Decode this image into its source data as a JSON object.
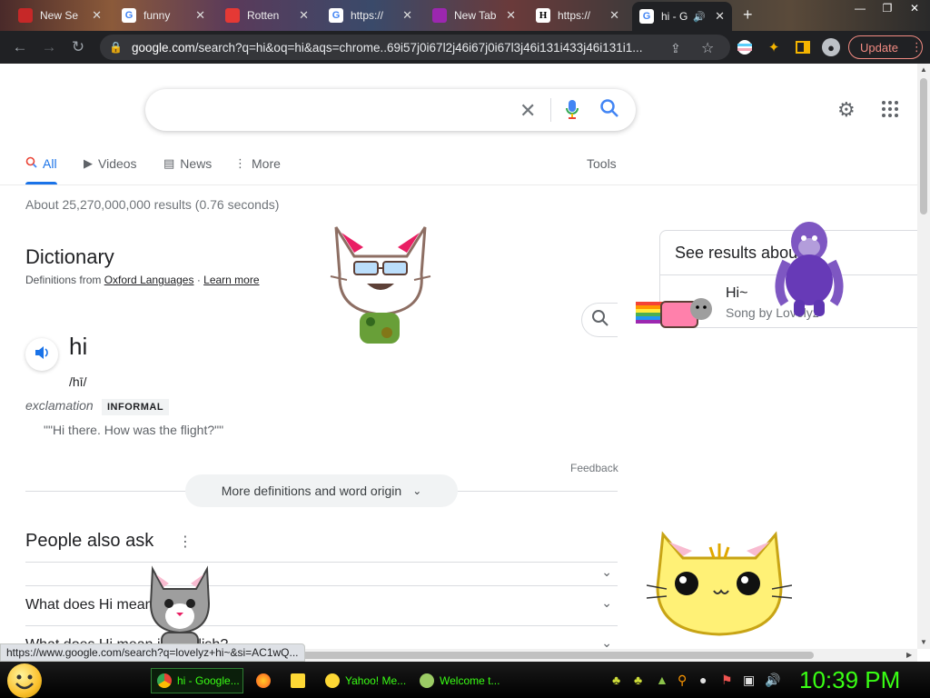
{
  "browser": {
    "tabs": [
      {
        "title": "New Se",
        "favicon_color": "#c62828",
        "active": false
      },
      {
        "title": "funny",
        "favicon_color": "#4285f4",
        "active": false
      },
      {
        "title": "Rotten",
        "favicon_color": "#e53935",
        "active": false
      },
      {
        "title": "https://",
        "favicon_color": "#4285f4",
        "active": false
      },
      {
        "title": "New Tab",
        "favicon_color": "#9c27b0",
        "active": false
      },
      {
        "title": "https://",
        "favicon_letter": "H",
        "favicon_color": "#ffffff",
        "active": false
      },
      {
        "title": "hi - G",
        "favicon_color": "#4285f4",
        "active": true
      }
    ],
    "url_domain": "google.com",
    "url_rest": "/search?q=hi&oq=hi&aqs=chrome..69i57j0i67l2j46i67j0i67l3j46i131i433j46i131i1...",
    "update_label": "Update"
  },
  "search": {
    "query": ""
  },
  "nav_tabs": [
    {
      "label": "All",
      "icon": "search-icon",
      "active": true
    },
    {
      "label": "Videos",
      "icon": "video-icon",
      "active": false
    },
    {
      "label": "News",
      "icon": "news-icon",
      "active": false
    },
    {
      "label": "More",
      "icon": "more-vert-icon",
      "active": false
    }
  ],
  "tools_label": "Tools",
  "result_stats": "About 25,270,000,000 results (0.76 seconds)",
  "dictionary": {
    "title": "Dictionary",
    "source_prefix": "Definitions from",
    "source_link": "Oxford Languages",
    "separator": "·",
    "learn_more": "Learn more",
    "word": "hi",
    "pronunciation": "/hī/",
    "part_of_speech": "exclamation",
    "register": "INFORMAL",
    "example": "\"\"Hi there. How was the flight?\"\"",
    "feedback": "Feedback",
    "more_definitions": "More definitions and word origin"
  },
  "people_also_ask": {
    "title": "People also ask",
    "questions": [
      "",
      "What does Hi mean?",
      "What does Hi mean in English?"
    ]
  },
  "knowledge_panel": {
    "title": "See results about",
    "item_name": "Hi~",
    "item_subtitle": "Song by Lovelyz"
  },
  "status_url": "https://www.google.com/search?q=lovelyz+hi~&si=AC1wQ...",
  "taskbar": {
    "buttons": [
      {
        "label": "hi - Google...",
        "active": true,
        "icon_color": "#4285f4"
      },
      {
        "label": "",
        "active": false,
        "icon_color": "#ff7043"
      },
      {
        "label": "",
        "active": false,
        "icon_color": "#fdd835"
      },
      {
        "label": "Yahoo! Me...",
        "active": false,
        "icon_color": "#fdd835"
      },
      {
        "label": "Welcome t...",
        "active": false,
        "icon_color": "#9ccc65"
      }
    ],
    "clock": "10:39 PM"
  },
  "colors": {
    "accent": "#1a73e8",
    "taskbar_text": "#39ff14",
    "update_border": "#f28b82"
  }
}
